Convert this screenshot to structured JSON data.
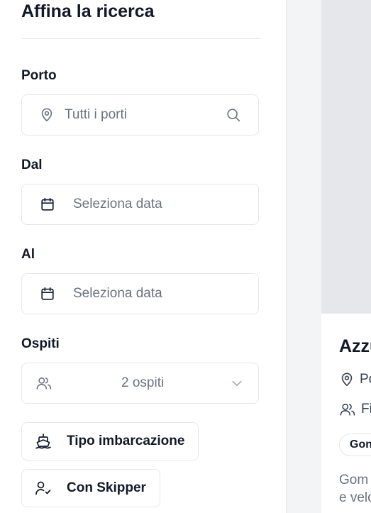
{
  "filters": {
    "title": "Affina la ricerca",
    "port": {
      "label": "Porto",
      "placeholder": "Tutti i porti"
    },
    "from": {
      "label": "Dal",
      "placeholder": "Seleziona data"
    },
    "to": {
      "label": "Al",
      "placeholder": "Seleziona data"
    },
    "guests": {
      "label": "Ospiti",
      "value": "2 ospiti"
    },
    "boat_type_button": "Tipo imbarcazione",
    "skipper_button": "Con Skipper"
  },
  "listing": {
    "title": "Azzu",
    "location": "Po",
    "people": "Fi",
    "chip": "Gon",
    "description_line1": "Gom",
    "description_line2": "e velo"
  },
  "icons": [
    "map-pin-icon",
    "search-icon",
    "calendar-icon",
    "users-icon",
    "chevron-down-icon",
    "ship-icon",
    "user-check-icon"
  ],
  "colors": {
    "border": "#e5e7eb",
    "placeholder": "#6b7280",
    "text": "#111827",
    "panel_bg": "#f3f4f6"
  }
}
